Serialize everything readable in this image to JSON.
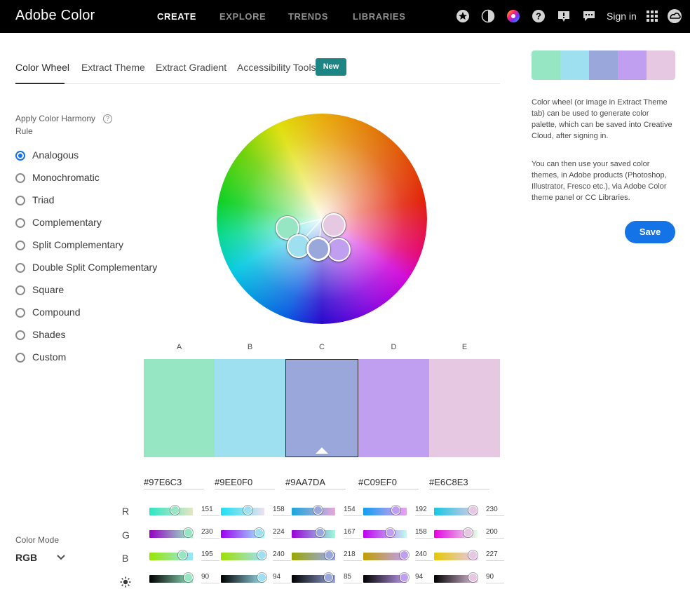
{
  "app": {
    "title": "Adobe Color",
    "nav": [
      "CREATE",
      "EXPLORE",
      "TRENDS",
      "LIBRARIES"
    ],
    "sign_in": "Sign in",
    "icons": [
      "star-icon",
      "contrast-icon",
      "color-wheel-icon",
      "help-icon",
      "alert-icon",
      "chat-icon",
      "apps-grid-icon",
      "creative-cloud-icon"
    ]
  },
  "tabs": {
    "items": [
      "Color Wheel",
      "Extract Theme",
      "Extract Gradient",
      "Accessibility Tools"
    ],
    "badge": "New",
    "active": "Color Wheel"
  },
  "harmony": {
    "title": "Apply Color Harmony Rule",
    "help": "?",
    "selected": "Analogous",
    "rules": [
      "Analogous",
      "Monochromatic",
      "Triad",
      "Complementary",
      "Split Complementary",
      "Double Split Complementary",
      "Square",
      "Compound",
      "Shades",
      "Custom"
    ]
  },
  "color_mode": {
    "label": "Color Mode",
    "value": "RGB"
  },
  "swatches": [
    {
      "letter": "A",
      "hex": "#97E6C3",
      "r": 151,
      "g": 230,
      "b": 195,
      "brightness": 90
    },
    {
      "letter": "B",
      "hex": "#9EE0F0",
      "r": 158,
      "g": 224,
      "b": 240,
      "brightness": 94
    },
    {
      "letter": "C",
      "hex": "#9AA7DA",
      "r": 154,
      "g": 167,
      "b": 218,
      "brightness": 85
    },
    {
      "letter": "D",
      "hex": "#C09EF0",
      "r": 192,
      "g": 158,
      "b": 240,
      "brightness": 94
    },
    {
      "letter": "E",
      "hex": "#E6C8E3",
      "r": 230,
      "g": 200,
      "b": 227,
      "brightness": 90
    }
  ],
  "selected_swatch": "C",
  "channels": [
    "R",
    "G",
    "B"
  ],
  "slider_gradients": {
    "r": [
      [
        "#2ee6c3",
        "#e6e6c3"
      ],
      [
        "#1ee0f0",
        "#eee0f0"
      ],
      [
        "#1aa7da",
        "#eaa7da"
      ],
      [
        "#109ef0",
        "#f09ef0"
      ],
      [
        "#16c8e3",
        "#e6c8e3"
      ]
    ],
    "g": [
      [
        "#9700c3",
        "#97ffc3"
      ],
      [
        "#9e00f0",
        "#9effff"
      ],
      [
        "#9a00da",
        "#9affda"
      ],
      [
        "#c000f0",
        "#c0fff0"
      ],
      [
        "#e600e3",
        "#e6ffe3"
      ]
    ],
    "b": [
      [
        "#97e600",
        "#97e6ff"
      ],
      [
        "#9ee000",
        "#9ee0ff"
      ],
      [
        "#9aa700",
        "#9aa7ff"
      ],
      [
        "#c09e00",
        "#c09eff"
      ],
      [
        "#e6c800",
        "#e6c8ff"
      ]
    ],
    "brightness": [
      [
        "#000000",
        "#97e6c3"
      ],
      [
        "#000000",
        "#9ee0f0"
      ],
      [
        "#000000",
        "#9aa7da"
      ],
      [
        "#000000",
        "#c09ef0"
      ],
      [
        "#000000",
        "#e6c8e3"
      ]
    ]
  },
  "right_panel": {
    "desc1": "Color wheel (or image in Extract Theme tab) can be used to generate color palette, which can be saved into Creative Cloud, after signing in.",
    "desc2": "You can then use your saved color themes, in Adobe products (Photoshop, Illustrator, Fresco etc.), via Adobe Color theme panel or CC Libraries.",
    "save": "Save"
  }
}
